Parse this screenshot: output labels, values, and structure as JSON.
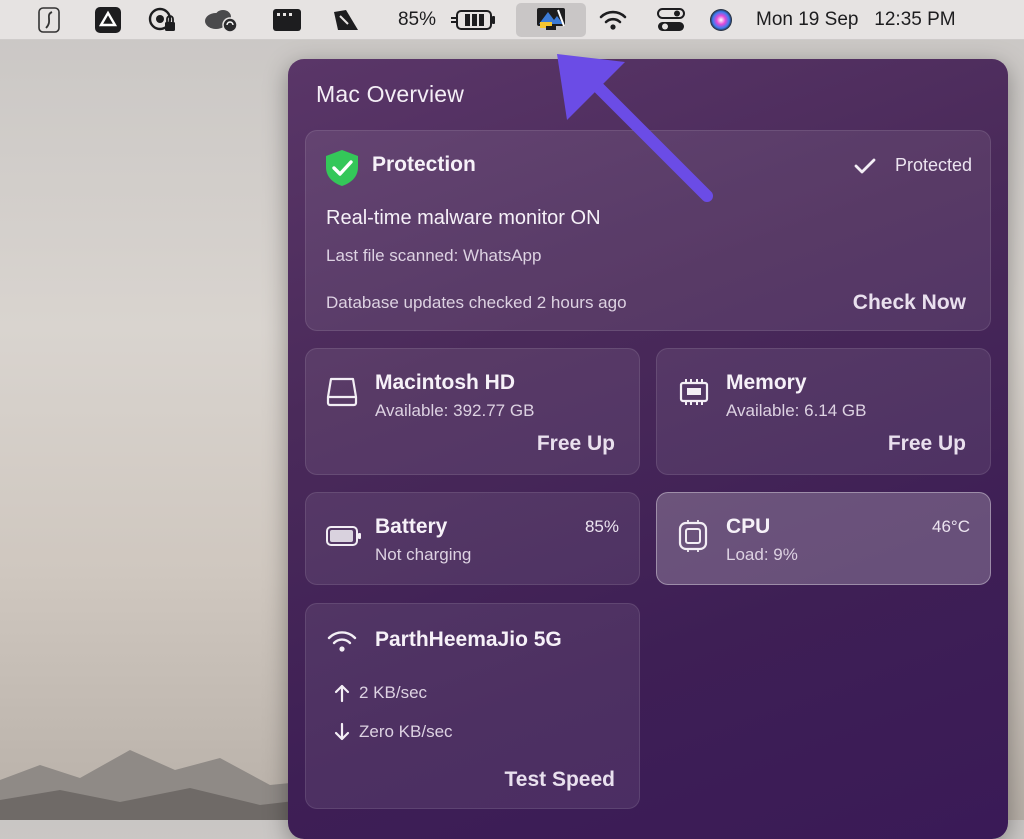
{
  "menubar": {
    "battery_percent": "85%",
    "datetime": "Mon 19 Sep   12:35 PM"
  },
  "panel": {
    "title": "Mac Overview",
    "protection": {
      "title": "Protection",
      "status": "Protected",
      "headline": "Real-time malware monitor ON",
      "last_scanned": "Last file scanned: WhatsApp",
      "db_status": "Database updates checked 2 hours ago",
      "action": "Check Now"
    },
    "disk": {
      "title": "Macintosh HD",
      "available": "Available: 392.77 GB",
      "action": "Free Up"
    },
    "memory": {
      "title": "Memory",
      "available": "Available: 6.14 GB",
      "action": "Free Up"
    },
    "battery": {
      "title": "Battery",
      "value": "85%",
      "status": "Not charging"
    },
    "cpu": {
      "title": "CPU",
      "value": "46°C",
      "load": "Load: 9%"
    },
    "network": {
      "title": "ParthHeemaJio 5G",
      "upload": "2 KB/sec",
      "download": "Zero KB/sec",
      "action": "Test Speed"
    }
  },
  "colors": {
    "panel_bg": "#4a2a5a",
    "shield_green": "#34c759",
    "arrow": "#6b4ce6"
  }
}
